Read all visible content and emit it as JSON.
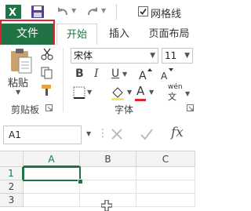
{
  "qat": {
    "gridlines_label": "网格线",
    "gridlines_checked": true
  },
  "tabs": {
    "file": "文件",
    "home": "开始",
    "insert": "插入",
    "page_layout": "页面布局"
  },
  "ribbon": {
    "clipboard": {
      "paste_label": "粘贴",
      "group_label": "剪贴板"
    },
    "font": {
      "font_name": "宋体",
      "font_size": "11",
      "bold": "B",
      "italic": "I",
      "underline": "U",
      "font_color_glyph": "A",
      "group_label": "字体",
      "phonetic_label": "wén"
    }
  },
  "formula_bar": {
    "name_box": "A1",
    "fx": "fx"
  },
  "grid": {
    "columns": [
      "A",
      "B",
      "C"
    ],
    "rows": [
      "1",
      "2",
      "3"
    ],
    "active_cell": "A1"
  },
  "colors": {
    "accent": "#217346",
    "highlight": "#e0242f",
    "font_color_bar": "#e0242f"
  }
}
